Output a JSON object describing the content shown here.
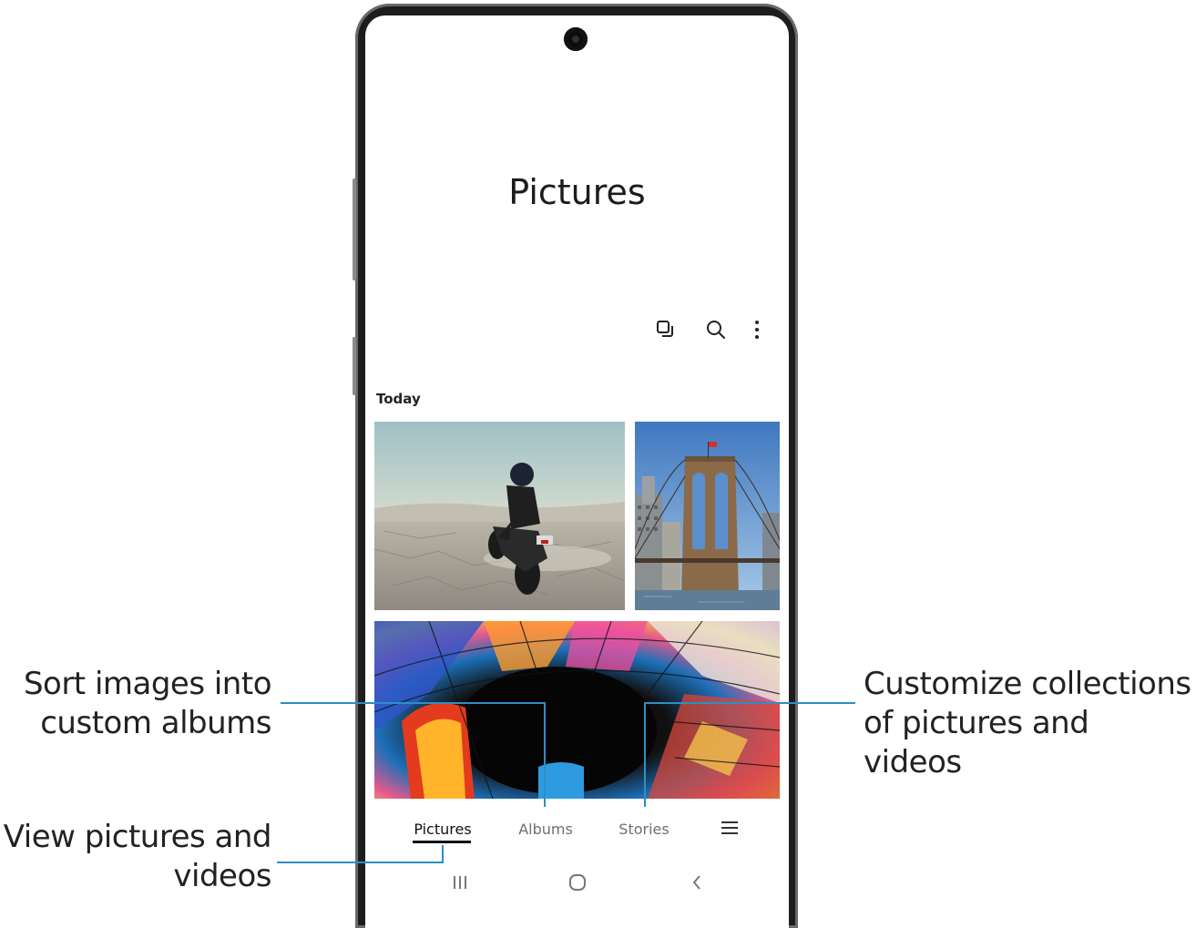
{
  "app": {
    "title": "Pictures",
    "section_label": "Today",
    "actions": [
      {
        "name": "select-icon"
      },
      {
        "name": "search-icon"
      },
      {
        "name": "more-options-icon"
      }
    ],
    "tabs": [
      {
        "label": "Pictures",
        "active": true
      },
      {
        "label": "Albums",
        "active": false
      },
      {
        "label": "Stories",
        "active": false
      },
      {
        "label": "",
        "icon": "menu-icon"
      }
    ],
    "system_nav": [
      "recents-icon",
      "home-icon",
      "back-icon"
    ]
  },
  "callouts": {
    "albums": [
      "Sort images into",
      "custom albums"
    ],
    "pictures": [
      "View pictures and",
      "videos"
    ],
    "stories": [
      "Customize collections",
      "of pictures and videos"
    ]
  },
  "colors": {
    "leader_line": "#2e8ec6",
    "frame": "#1d1d1f"
  }
}
